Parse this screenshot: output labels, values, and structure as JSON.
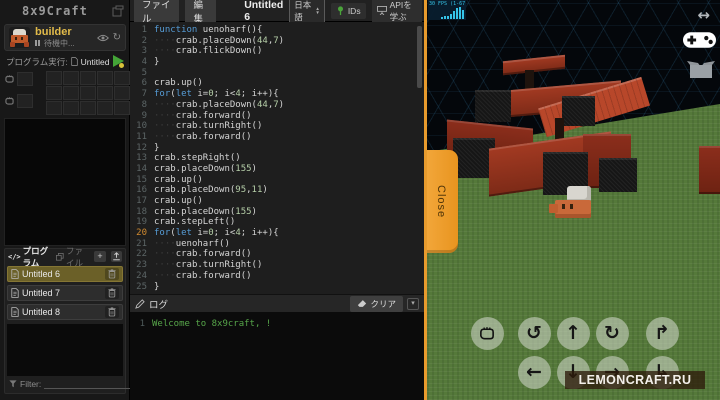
{
  "app": {
    "logo": "8x9Craft"
  },
  "menubar": {
    "file": "ファイル",
    "edit": "編集",
    "title": "Untitled 6",
    "language": "日本語",
    "ids_label": "IDs",
    "api_label": "APIを学ぶ"
  },
  "sidebar": {
    "character": {
      "name": "builder",
      "status": "待機中..."
    },
    "run_label": "プログラム実行:",
    "run_file": "Untitled 6",
    "inventory": {
      "hand_slots": 2,
      "grid_cols": 5,
      "grid_rows": 3
    },
    "tabs": {
      "program": "プログラム",
      "file": "ファイル",
      "program_icon": "</>",
      "add": "+"
    },
    "files": [
      {
        "name": "Untitled 6",
        "selected": true
      },
      {
        "name": "Untitled 7",
        "selected": false
      },
      {
        "name": "Untitled 8",
        "selected": false
      }
    ],
    "filter_label": "Filter:",
    "filter_clear": "×"
  },
  "editor": {
    "active_line": 20,
    "lines": [
      "function uenoharf(){",
      "    crab.placeDown(44,7)",
      "    crab.flickDown()",
      "}",
      "",
      "crab.up()",
      "for(let i=0; i<4; i++){",
      "    crab.placeDown(44,7)",
      "    crab.forward()",
      "    crab.turnRight()",
      "    crab.forward()",
      "}",
      "crab.stepRight()",
      "crab.placeDown(155)",
      "crab.up()",
      "crab.placeDown(95,11)",
      "crab.up()",
      "crab.placeDown(155)",
      "crab.stepLeft()",
      "for(let i=0; i<4; i++){",
      "    uenoharf()",
      "    crab.forward()",
      "    crab.turnRight()",
      "    crab.forward()",
      "}"
    ]
  },
  "log": {
    "title": "ログ",
    "clear_label": "クリア",
    "collapse_glyph": "▾",
    "entries": [
      {
        "n": "1",
        "text": "Welcome to 8x9craft, !"
      }
    ]
  },
  "game": {
    "fps": {
      "text": "30 FPS (1-67)",
      "bars": [
        2,
        3,
        3,
        5,
        8,
        11,
        12,
        9
      ]
    },
    "close_label": "Close",
    "watermark": "LEMONCRAFT.RU",
    "controls": {
      "row1": [
        "hand",
        "↺",
        "↑",
        "↻",
        "↱"
      ],
      "row2": [
        "←",
        "↓",
        "→",
        "↳"
      ]
    },
    "resize_glyph": "↔"
  },
  "colors": {
    "accent_orange": "#E89B2D",
    "selected_file_bg": "#6B6028",
    "log_green": "#57A64A",
    "fps_cyan": "#35C4E8",
    "keyword_blue": "#569CD6",
    "number_green": "#B5CEA8",
    "grass_green": "#55793A",
    "brick_red": "#A33A22"
  }
}
